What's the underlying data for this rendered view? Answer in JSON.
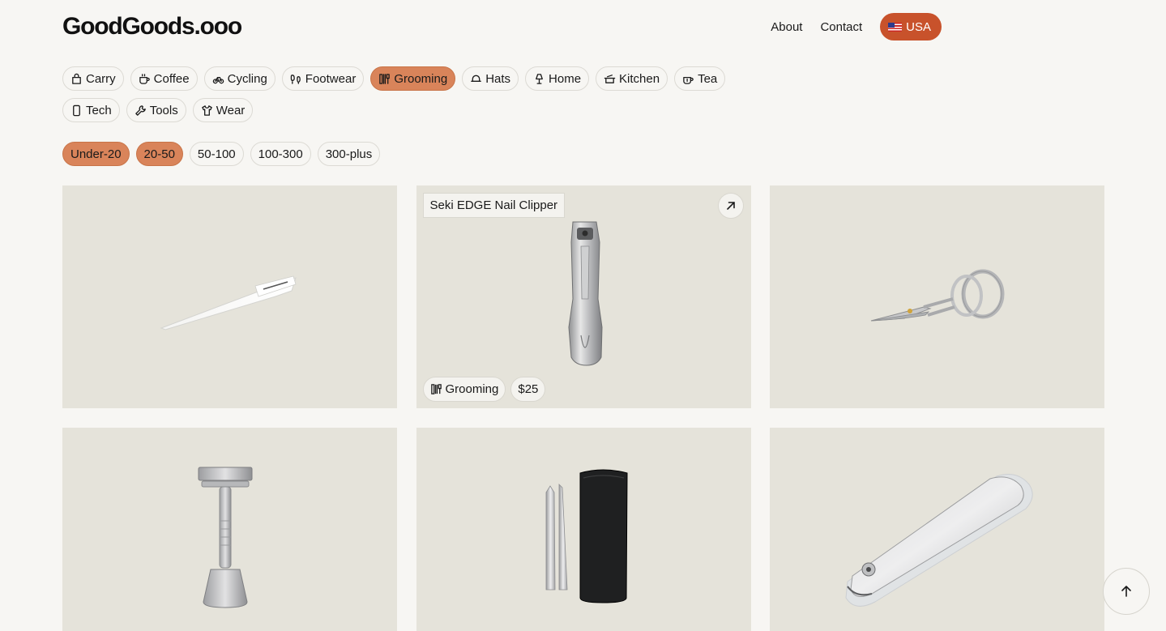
{
  "header": {
    "logo": "GoodGoods.ooo",
    "nav": [
      "About",
      "Contact"
    ],
    "country_label": "USA",
    "country_flag_icon": "us-flag-icon"
  },
  "categories": [
    {
      "label": "Carry",
      "icon": "bag-icon",
      "active": false
    },
    {
      "label": "Coffee",
      "icon": "coffee-cup-icon",
      "active": false
    },
    {
      "label": "Cycling",
      "icon": "bicycle-icon",
      "active": false
    },
    {
      "label": "Footwear",
      "icon": "footprints-icon",
      "active": false
    },
    {
      "label": "Grooming",
      "icon": "grooming-tools-icon",
      "active": true
    },
    {
      "label": "Hats",
      "icon": "hat-icon",
      "active": false
    },
    {
      "label": "Home",
      "icon": "lamp-icon",
      "active": false
    },
    {
      "label": "Kitchen",
      "icon": "pot-icon",
      "active": false
    },
    {
      "label": "Tea",
      "icon": "tea-cup-icon",
      "active": false
    },
    {
      "label": "Tech",
      "icon": "phone-icon",
      "active": false
    },
    {
      "label": "Tools",
      "icon": "wrench-icon",
      "active": false
    },
    {
      "label": "Wear",
      "icon": "shirt-icon",
      "active": false
    }
  ],
  "price_filters": [
    {
      "label": "Under-20",
      "active": true
    },
    {
      "label": "20-50",
      "active": true
    },
    {
      "label": "50-100",
      "active": false
    },
    {
      "label": "100-300",
      "active": false
    },
    {
      "label": "300-plus",
      "active": false
    }
  ],
  "products": [
    {
      "image": "glass-nail-file",
      "hover": false
    },
    {
      "image": "nail-clipper-upright",
      "hover": true,
      "title": "Seki EDGE Nail Clipper",
      "category": "Grooming",
      "price": "$25"
    },
    {
      "image": "nail-scissors",
      "hover": false
    },
    {
      "image": "safety-razor-stand",
      "hover": false
    },
    {
      "image": "tweezers-set-case",
      "hover": false
    },
    {
      "image": "nail-clipper-type003",
      "hover": false
    }
  ],
  "accent_colors": {
    "active_chip": "#d9845a",
    "country_button": "#c8522b",
    "card_bg": "#e5e3da"
  }
}
